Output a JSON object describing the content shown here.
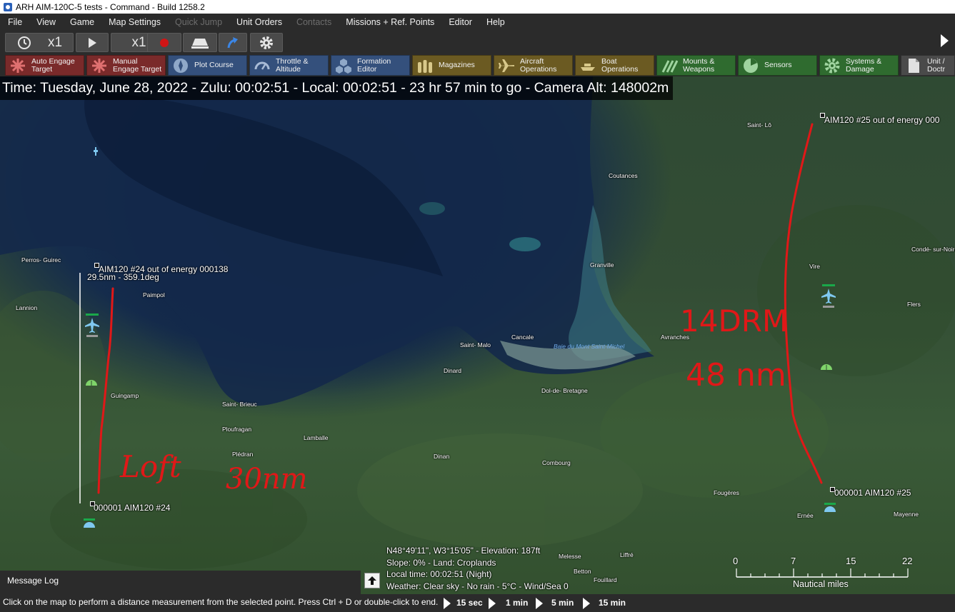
{
  "window": {
    "title": "ARH AIM-120C-5 tests - Command - Build 1258.2"
  },
  "menu": {
    "items": [
      {
        "label": "File",
        "enabled": true
      },
      {
        "label": "View",
        "enabled": true
      },
      {
        "label": "Game",
        "enabled": true
      },
      {
        "label": "Map Settings",
        "enabled": true
      },
      {
        "label": "Quick Jump",
        "enabled": false
      },
      {
        "label": "Unit Orders",
        "enabled": true
      },
      {
        "label": "Contacts",
        "enabled": false
      },
      {
        "label": "Missions + Ref. Points",
        "enabled": true
      },
      {
        "label": "Editor",
        "enabled": true
      },
      {
        "label": "Help",
        "enabled": true
      }
    ]
  },
  "controls": {
    "time_compression_1": "x1",
    "time_compression_2": "x1",
    "icons": [
      "clock-icon",
      "play-icon",
      "step-play-icon",
      "record-icon",
      "bridge-icon",
      "route-arrow-icon",
      "gear-icon"
    ],
    "expand_icon": "expand-arrow-icon"
  },
  "panels": [
    {
      "label": "Auto Engage\nTarget",
      "color": "#7a2a2a",
      "icon": "target-burst-icon"
    },
    {
      "label": "Manual\nEngage Target",
      "color": "#7a2a2a",
      "icon": "target-burst-icon"
    },
    {
      "label": "Plot Course",
      "color": "#34507c",
      "icon": "compass-icon"
    },
    {
      "label": "Throttle &\nAltitude",
      "color": "#34507c",
      "icon": "gauge-icon"
    },
    {
      "label": "Formation\nEditor",
      "color": "#34507c",
      "icon": "hexagons-icon"
    },
    {
      "label": "Magazines",
      "color": "#6b5a22",
      "icon": "ammo-icon"
    },
    {
      "label": "Aircraft\nOperations",
      "color": "#6b5a22",
      "icon": "aircraft-icon"
    },
    {
      "label": "Boat\nOperations",
      "color": "#6b5a22",
      "icon": "boat-icon"
    },
    {
      "label": "Mounts &\nWeapons",
      "color": "#2f6b2f",
      "icon": "missiles-icon"
    },
    {
      "label": "Sensors",
      "color": "#2f6b2f",
      "icon": "radar-icon"
    },
    {
      "label": "Systems &\nDamage",
      "color": "#2f6b2f",
      "icon": "cog-icon"
    },
    {
      "label": "Unit /\nDoctr",
      "color": "#4a4a4a",
      "icon": "document-icon"
    }
  ],
  "time_banner": "Time: Tuesday, June 28, 2022 - Zulu: 00:02:51 - Local: 00:02:51 - 23 hr 57 min to go -  Camera Alt: 148002m",
  "map": {
    "towns": [
      "Saint-\nLô",
      "Coutances",
      "Condé-\nsur-Noireau",
      "Vire",
      "Flers",
      "Granville",
      "Avranches",
      "Cancale",
      "Baie du Mont\nSaint-Michel",
      "Saint-\nMalo",
      "Dinard",
      "Dol-de-\nBretagne",
      "Perros-\nGuirec",
      "Lannion",
      "Paimpol",
      "Guingamp",
      "Saint-\nBrieuc",
      "Ploufragan",
      "Lamballe",
      "Plédran",
      "Dinan",
      "Combourg",
      "Fougères",
      "Ernée",
      "Mayenne",
      "Melesse",
      "Liffré",
      "Betton",
      "Fouillard"
    ],
    "units": [
      {
        "label": "AIM120 #25 out of energy 000",
        "icon": "waypoint-icon"
      },
      {
        "label": "AIM120 #24 out of energy 000138",
        "icon": "waypoint-icon"
      },
      {
        "label": "29.5nm - 359.1deg",
        "icon": "measure-line-icon"
      },
      {
        "label": "000001 AIM120 #24",
        "icon": "waypoint-icon"
      },
      {
        "label": "000001 AIM120 #25",
        "icon": "waypoint-icon"
      }
    ],
    "aircraft_icons": [
      "aircraft-icon",
      "aircraft-icon"
    ],
    "base_icons": [
      "airbase-icon",
      "airbase-icon",
      "airbase-icon",
      "airbase-icon"
    ],
    "annotations": {
      "left_line_1": "Loft",
      "left_line_2": "30nm",
      "right_line_1": "14DRM",
      "right_line_2": "48 nm",
      "ink_color": "#e01818"
    }
  },
  "cursor_info": {
    "coords": "N48°49'11\", W3°15'05\" - Elevation: 187ft",
    "terrain": "Slope: 0%  - Land: Croplands",
    "local_time": "Local time: 00:02:51 (Night)",
    "weather": "Weather: Clear sky - No rain - 5°C - Wind/Sea 0"
  },
  "scale_bar": {
    "ticks": [
      "0",
      "7",
      "15",
      "22"
    ],
    "unit": "Nautical miles"
  },
  "message_log": {
    "title": "Message Log"
  },
  "status_bar": {
    "hint": "Click on the map to perform a distance measurement from the selected point. Press Ctrl + D or double-click to end.",
    "speed_buttons": [
      "15 sec",
      "1 min",
      "5 min",
      "15 min"
    ]
  },
  "colors": {
    "chrome": "#2b2b2b",
    "water_deep": "#102446",
    "land": "#33502f",
    "annotation_red": "#e01818"
  }
}
